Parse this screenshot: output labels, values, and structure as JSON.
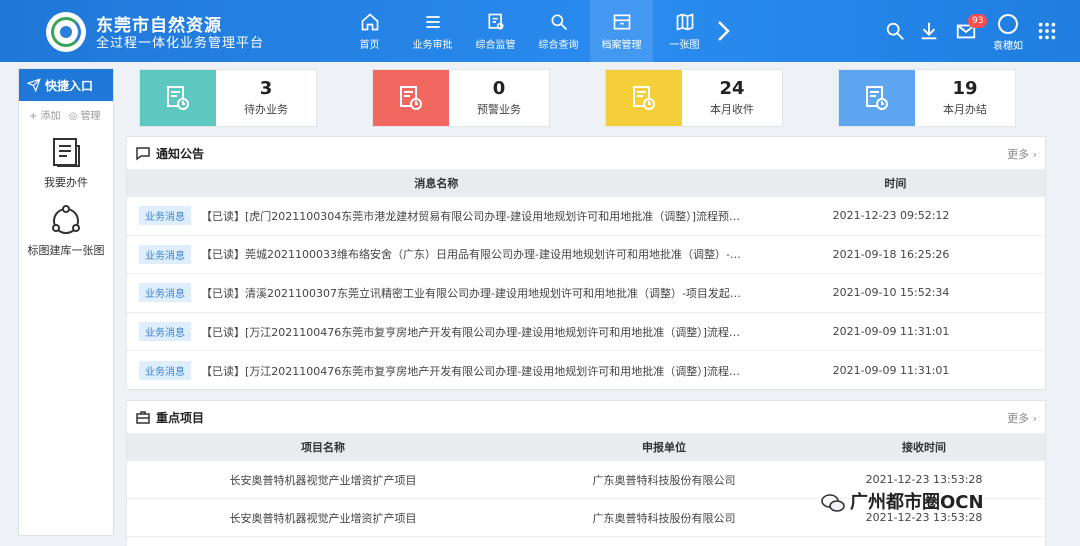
{
  "app": {
    "title": "东莞市自然资源",
    "subtitle": "全过程一体化业务管理平台"
  },
  "nav": [
    {
      "label": "首页",
      "icon": "home-icon"
    },
    {
      "label": "业务审批",
      "icon": "list-icon"
    },
    {
      "label": "综合监管",
      "icon": "monitor-icon"
    },
    {
      "label": "综合查询",
      "icon": "search-icon"
    },
    {
      "label": "档案管理",
      "icon": "archive-icon"
    },
    {
      "label": "一张图",
      "icon": "map-icon"
    }
  ],
  "header": {
    "badge_count": "93",
    "user_name": "袁穗如"
  },
  "sidebar": {
    "title": "快捷入口",
    "add_label": "+ 添加",
    "manage_label": "管理",
    "entries": [
      {
        "label": "我要办件",
        "icon": "document-icon"
      },
      {
        "label": "标图建库一张图",
        "icon": "share-network-icon"
      }
    ]
  },
  "stats": [
    {
      "value": "3",
      "label": "待办业务",
      "color": "#5cc8c0"
    },
    {
      "value": "0",
      "label": "预警业务",
      "color": "#f2675f"
    },
    {
      "value": "24",
      "label": "本月收件",
      "color": "#f5cf3a"
    },
    {
      "value": "19",
      "label": "本月办结",
      "color": "#5ea7f0"
    }
  ],
  "notices": {
    "title": "通知公告",
    "more": "更多",
    "col_name": "消息名称",
    "col_time": "时间",
    "rows": [
      {
        "tag": "业务消息",
        "text": "【已读】[虎门2021100304东莞市港龙建材贸易有限公司办理-建设用地规划许可和用地批准（调整）]流程预警...",
        "time": "2021-12-23 09:52:12"
      },
      {
        "tag": "业务消息",
        "text": "【已读】莞城2021100033维布络安舍（广东）日用品有限公司办理-建设用地规划许可和用地批准（调整）-项...",
        "time": "2021-09-18 16:25:26"
      },
      {
        "tag": "业务消息",
        "text": "【已读】清溪2021100307东莞立讯精密工业有限公司办理-建设用地规划许可和用地批准（调整）-项目发起子...",
        "time": "2021-09-10 15:52:34"
      },
      {
        "tag": "业务消息",
        "text": "【已读】[万江2021100476东莞市复亨房地产开发有限公司办理-建设用地规划许可和用地批准（调整）]流程预...",
        "time": "2021-09-09 11:31:01"
      },
      {
        "tag": "业务消息",
        "text": "【已读】[万江2021100476东莞市复亨房地产开发有限公司办理-建设用地规划许可和用地批准（调整）]流程预...",
        "time": "2021-09-09 11:31:01"
      }
    ]
  },
  "projects": {
    "title": "重点项目",
    "more": "更多",
    "col_name": "项目名称",
    "col_unit": "申报单位",
    "col_time": "接收时间",
    "rows": [
      {
        "name": "长安奥普特机器视觉产业增资扩产项目",
        "unit": "广东奥普特科技股份有限公司",
        "time": "2021-12-23 13:53:28"
      },
      {
        "name": "长安奥普特机器视觉产业增资扩产项目",
        "unit": "广东奥普特科技股份有限公司",
        "time": "2021-12-23 13:53:28"
      }
    ]
  },
  "watermark_text": "广州都市圈OCN"
}
